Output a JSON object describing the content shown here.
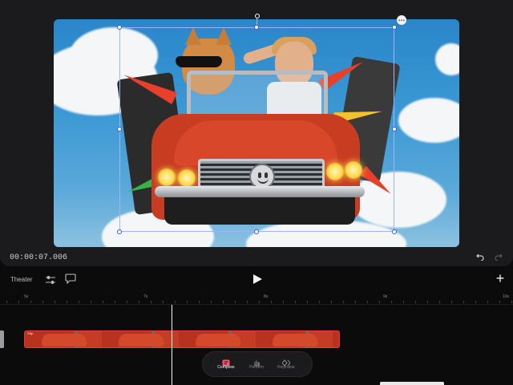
{
  "preview": {
    "timecode": "00:00:07.006",
    "undo_icon": "undo-icon",
    "redo_icon": "redo-icon",
    "more_icon": "more-horizontal-icon"
  },
  "toolbar": {
    "theater_label": "Theater",
    "adjust_icon": "sliders-icon",
    "comment_icon": "comment-icon",
    "play_icon": "play-icon",
    "add_icon": "plus-icon",
    "add_label": "+"
  },
  "timeline": {
    "ruler_labels": [
      "5s",
      "7s",
      "8s",
      "9s",
      "10s"
    ],
    "clip_label": "Clip"
  },
  "modes": [
    {
      "label": "Compose",
      "icon": "compose-icon",
      "active": true
    },
    {
      "label": "Perform",
      "icon": "hand-icon",
      "active": false
    },
    {
      "label": "Keyframe",
      "icon": "keyframe-icon",
      "active": false
    }
  ],
  "colors": {
    "accent_red": "#e23b3b",
    "selection": "#9fb3ff",
    "compose_active": "#ff5a6e"
  }
}
